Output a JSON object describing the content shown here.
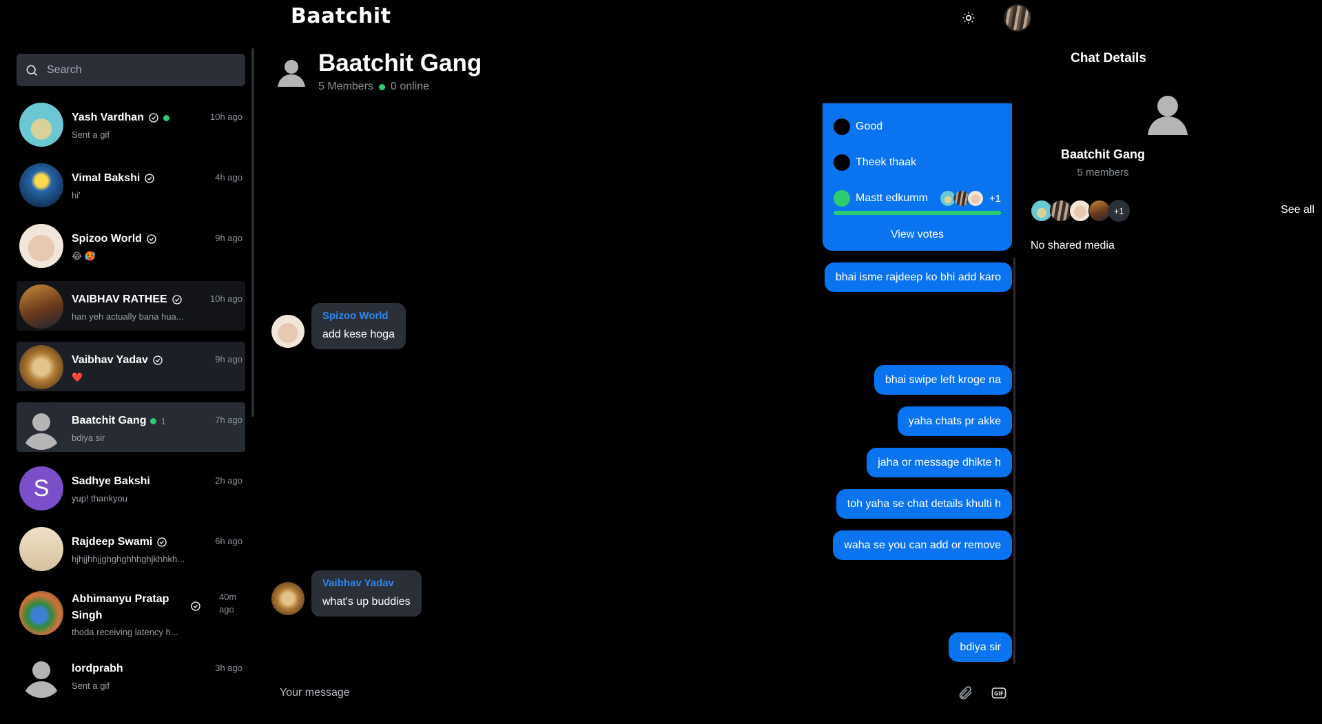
{
  "header": {
    "brand": "Baatchit"
  },
  "search": {
    "placeholder": "Search"
  },
  "chats": [
    {
      "name": "Yash Vardhan",
      "preview": "Sent a gif",
      "time": "10h ago"
    },
    {
      "name": "Vimal Bakshi",
      "preview": "hi'",
      "time": "4h ago"
    },
    {
      "name": "Spizoo World",
      "preview": "😂 🥵",
      "time": "9h ago"
    },
    {
      "name": "VAIBHAV RATHEE",
      "preview": "han yeh actually bana hua...",
      "time": "10h ago"
    },
    {
      "name": "Vaibhav Yadav",
      "preview": "❤️",
      "time": "9h ago"
    },
    {
      "name": "Baatchit Gang",
      "preview": "bdiya sir",
      "time": "7h ago",
      "online_count": "1"
    },
    {
      "name": "Sadhye Bakshi",
      "preview": "yup! thankyou",
      "time": "2h ago",
      "initial": "S"
    },
    {
      "name": "Rajdeep Swami",
      "preview": "hjhjjhhjjghghghhhghjkhhkh...",
      "time": "6h ago"
    },
    {
      "name": "Abhimanyu Pratap Singh",
      "preview": "thoda receiving latency h...",
      "time": "40m ago"
    },
    {
      "name": "lordprabh",
      "preview": "Sent a gif",
      "time": "3h ago"
    }
  ],
  "conversation": {
    "title": "Baatchit Gang",
    "members": "5 Members",
    "online": "0 online",
    "poll": {
      "options": [
        "Good",
        "Theek thaak",
        "Mastt edkumm"
      ],
      "extra_voters": "+1",
      "view_votes": "View votes"
    },
    "messages": {
      "m1": "bhai isme rajdeep ko bhi add karo",
      "in1_sender": "Spizoo World",
      "in1_text": "add kese hoga",
      "m2": "bhai swipe left kroge na",
      "m3": "yaha chats pr akke",
      "m4": "jaha or message dhikte h",
      "m5": "toh yaha se chat details khulti h",
      "m6": "waha se you can add or remove",
      "in2_sender": "Vaibhav Yadav",
      "in2_text": "what's up buddies",
      "m7": "bdiya sir"
    },
    "composer_placeholder": "Your message"
  },
  "details": {
    "title": "Chat Details",
    "name": "Baatchit Gang",
    "count": "5 members",
    "more": "+1",
    "see_all": "See all",
    "media": "No shared media"
  },
  "colors": {
    "accent": "#0a74f0",
    "online": "#2ecc71",
    "panel": "#2b2f38"
  }
}
